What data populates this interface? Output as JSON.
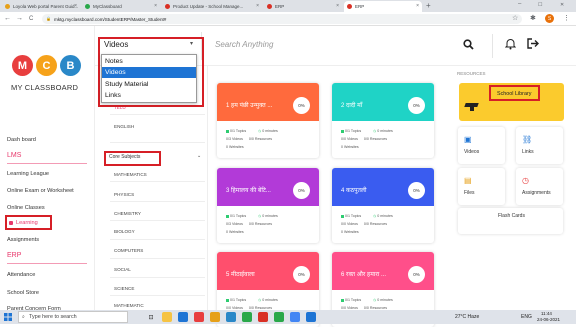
{
  "browser": {
    "tabs": [
      {
        "label": "Loyola Web portal Parent Guid..."
      },
      {
        "label": "MyClassboard"
      },
      {
        "label": "Product Update - School Manage..."
      },
      {
        "label": "ERP"
      },
      {
        "label": "ERP"
      }
    ],
    "url": "mktg.myclassboard.com/StudentERP/Master_Student#",
    "new_tab": "+",
    "close_glyph": "×",
    "back": "←",
    "forward": "→",
    "reload": "C",
    "lock": "🔒",
    "minimize": "–",
    "maximize": "☐",
    "close_window": "✕",
    "star": "☆",
    "ext": "✱",
    "profile": "S",
    "menu": "⋮",
    "search_tabs": "⌄"
  },
  "logo": {
    "letters": [
      "M",
      "C",
      "B"
    ],
    "text": "MY CLASSBOARD",
    "colors": [
      "#e83e3e",
      "#f6a21a",
      "#2a88c8"
    ]
  },
  "sidebar": {
    "dashboard": "Dash board",
    "lms_head": "LMS",
    "lms_items": [
      "Learning League",
      "Online Exam or Worksheet",
      "Online Classes",
      "Learning",
      "Assignments"
    ],
    "erp_head": "ERP",
    "erp_items": [
      "Attendance",
      "School Store",
      "Parent Concern Form"
    ]
  },
  "header": {
    "select_value": "Videos",
    "select_arrow": "▾",
    "search_placeholder": "Search Anything",
    "search_icon": "search-icon",
    "bell_icon": "bell-icon",
    "logout_icon": "logout-icon"
  },
  "dropdown": {
    "options": [
      "Notes",
      "Videos",
      "Study Material",
      "Links"
    ],
    "selected": "Videos"
  },
  "subjects": {
    "languages": [
      "TELU",
      "ENGLISH"
    ],
    "core_head": "Core Subjects",
    "core_arrow": "⌄",
    "core_items": [
      "MATHEMATICS",
      "PHYSICS",
      "CHEMISTRY",
      "BIOLOGY",
      "COMPUTERS",
      "SOCIAL",
      "SCIENCE",
      "MATHEMATIC"
    ]
  },
  "cards": [
    {
      "title": "1 हम पंछी उन्मुक्त ...",
      "pct": "0%",
      "topics": "0/1 Topics",
      "minutes": "0 minutes",
      "videos": "0/3 Videos",
      "resources": "0/0 Resources",
      "websites": "0 Websites",
      "color": "#ff6a3d"
    },
    {
      "title": "2 दादी माँ",
      "pct": "0%",
      "topics": "0/1 Topics",
      "minutes": "0 minutes",
      "videos": "0/0 Videos",
      "resources": "0/0 Resources",
      "websites": "0 Websites",
      "color": "#1fd3c6"
    },
    {
      "title": "3 हिमालय की बेटि...",
      "pct": "0%",
      "topics": "0/1 Topics",
      "minutes": "0 minutes",
      "videos": "0/3 Videos",
      "resources": "0/0 Resources",
      "websites": "0 Websites",
      "color": "#b23ad8"
    },
    {
      "title": "4 कठपुतली",
      "pct": "0%",
      "topics": "0/1 Topics",
      "minutes": "0 minutes",
      "videos": "0/0 Videos",
      "resources": "0/0 Resources",
      "websites": "0 Websites",
      "color": "#3a5cf0"
    },
    {
      "title": "5 मीठाईवाला",
      "pct": "0%",
      "topics": "0/1 Topics",
      "minutes": "0 minutes",
      "videos": "0/0 Videos",
      "resources": "0/0 Resources",
      "websites": "0 Websites",
      "color": "#ff4f6d"
    },
    {
      "title": "6 रक्त और हमारा ...",
      "pct": "0%",
      "topics": "0/1 Topics",
      "minutes": "0 minutes",
      "videos": "0/0 Videos",
      "resources": "0/0 Resources",
      "websites": "0 Websites",
      "color": "#ff4f8a"
    }
  ],
  "resources": {
    "head": "RESOURCES",
    "library": "School Library",
    "videos": "Videos",
    "links": "Links",
    "files": "Files",
    "assignments": "Assignments",
    "flash": "Flash Cards"
  },
  "taskbar": {
    "search": "Type here to search",
    "weather": "27°C Haze",
    "lang": "ENG",
    "time": "11:44",
    "date": "24-06-2021"
  }
}
